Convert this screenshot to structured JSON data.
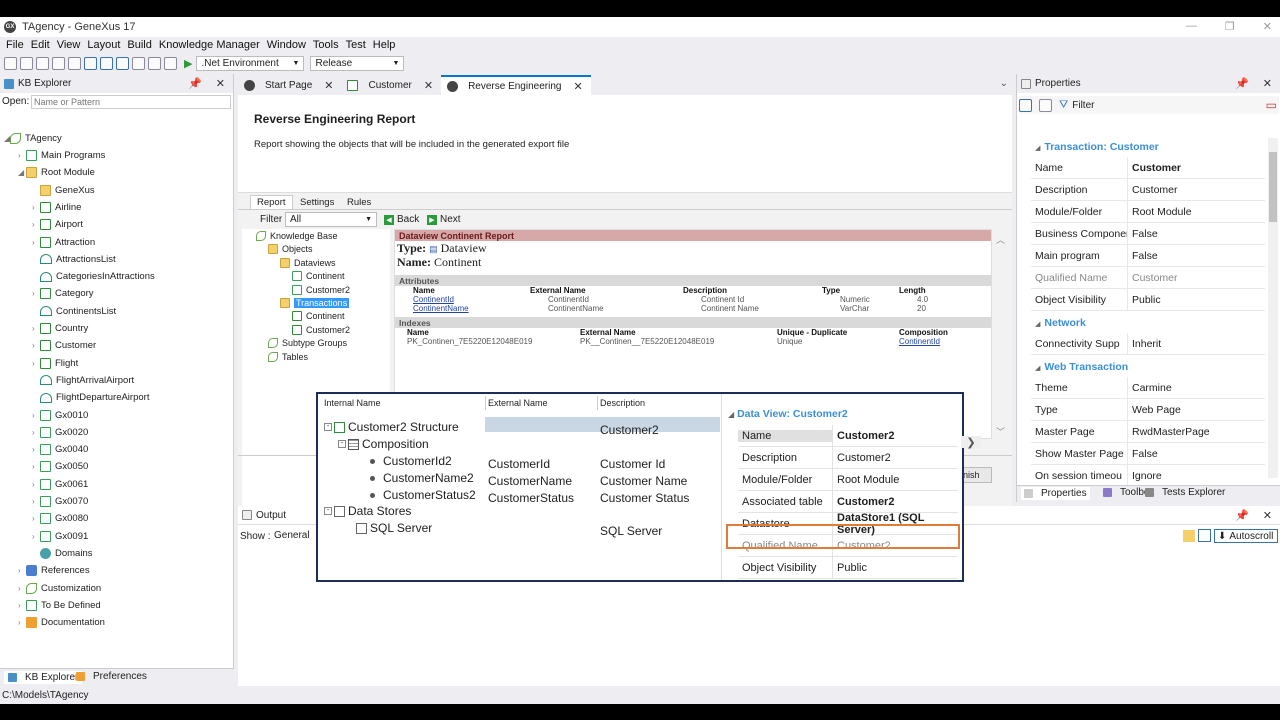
{
  "app": {
    "title": "TAgency - GeneXus 17"
  },
  "menu": [
    "File",
    "Edit",
    "View",
    "Layout",
    "Build",
    "Knowledge Manager",
    "Window",
    "Tools",
    "Test",
    "Help"
  ],
  "toolbar": {
    "environment": ".Net Environment",
    "config": "Release"
  },
  "kb_explorer": {
    "title": "KB Explorer",
    "open_label": "Open:",
    "open_placeholder": "Name or Pattern",
    "root": "TAgency",
    "items": [
      {
        "label": "Main Programs"
      },
      {
        "label": "Root Module"
      },
      {
        "label": "GeneXus"
      },
      {
        "label": "Airline"
      },
      {
        "label": "Airport"
      },
      {
        "label": "Attraction"
      },
      {
        "label": "AttractionsList"
      },
      {
        "label": "CategoriesInAttractions"
      },
      {
        "label": "Category"
      },
      {
        "label": "ContinentsList"
      },
      {
        "label": "Country"
      },
      {
        "label": "Customer"
      },
      {
        "label": "Flight"
      },
      {
        "label": "FlightArrivalAirport"
      },
      {
        "label": "FlightDepartureAirport"
      },
      {
        "label": "Gx0010"
      },
      {
        "label": "Gx0020"
      },
      {
        "label": "Gx0040"
      },
      {
        "label": "Gx0050"
      },
      {
        "label": "Gx0061"
      },
      {
        "label": "Gx0070"
      },
      {
        "label": "Gx0080"
      },
      {
        "label": "Gx0091"
      },
      {
        "label": "Domains"
      },
      {
        "label": "References"
      },
      {
        "label": "Customization"
      },
      {
        "label": "To Be Defined"
      },
      {
        "label": "Documentation"
      }
    ],
    "bottom_tabs": [
      "KB Explorer",
      "Preferences"
    ]
  },
  "tabs": [
    "Start Page",
    "Customer",
    "Reverse Engineering"
  ],
  "report": {
    "title": "Reverse Engineering Report",
    "subtitle": "Report showing the objects that will be included in the generated export file",
    "inner_tabs": [
      "Report",
      "Settings",
      "Rules"
    ],
    "filter_label": "Filter",
    "filter_value": "All",
    "back": "Back",
    "next": "Next",
    "tree": [
      "Knowledge Base",
      "Objects",
      "Dataviews",
      "Continent",
      "Customer2",
      "Transactions",
      "Continent",
      "Customer2",
      "Subtype Groups",
      "Tables"
    ],
    "view": {
      "header": "Dataview Continent Report",
      "type_label": "Type:",
      "type_value": "Dataview",
      "name_label": "Name:",
      "name_value": "Continent",
      "attributes_label": "Attributes",
      "attr_cols": [
        "Name",
        "External Name",
        "Description",
        "Type",
        "Length"
      ],
      "attr_rows": [
        [
          "ContinentId",
          "ContinentId",
          "Continent Id",
          "Numeric",
          "4.0"
        ],
        [
          "ContinentName",
          "ContinentName",
          "Continent Name",
          "VarChar",
          "20"
        ]
      ],
      "indexes_label": "Indexes",
      "idx_cols": [
        "Name",
        "External Name",
        "Unique - Duplicate",
        "Composition"
      ],
      "idx_row": [
        "PK_Continen_7E5220E12048E019",
        "PK__Continen__7E5220E12048E019",
        "Unique",
        "ContinentId"
      ]
    },
    "finish_fragment": "nish"
  },
  "overlay": {
    "cols": [
      "Internal Name",
      "External Name",
      "Description"
    ],
    "rows": [
      {
        "name": "Customer2 Structure",
        "ext": "",
        "desc": "Customer2"
      },
      {
        "name": "Composition",
        "ext": "",
        "desc": ""
      },
      {
        "name": "CustomerId2",
        "ext": "CustomerId",
        "desc": "Customer Id"
      },
      {
        "name": "CustomerName2",
        "ext": "CustomerName",
        "desc": "Customer Name"
      },
      {
        "name": "CustomerStatus2",
        "ext": "CustomerStatus",
        "desc": "Customer Status"
      },
      {
        "name": "Data Stores",
        "ext": "",
        "desc": ""
      },
      {
        "name": "SQL Server",
        "ext": "",
        "desc": "SQL Server"
      }
    ],
    "props_title": "Data View: Customer2",
    "props": [
      [
        "Name",
        "Customer2"
      ],
      [
        "Description",
        "Customer2"
      ],
      [
        "Module/Folder",
        "Root Module"
      ],
      [
        "Associated table",
        "Customer2"
      ],
      [
        "Datastore",
        "DataStore1 (SQL Server)"
      ],
      [
        "Qualified Name",
        "Customer2"
      ],
      [
        "Object Visibility",
        "Public"
      ]
    ]
  },
  "properties": {
    "title": "Properties",
    "filter": "Filter",
    "section1": "Transaction: Customer",
    "rows1": [
      [
        "Name",
        "Customer"
      ],
      [
        "Description",
        "Customer"
      ],
      [
        "Module/Folder",
        "Root Module"
      ],
      [
        "Business Componen",
        "False"
      ],
      [
        "Main program",
        "False"
      ],
      [
        "Qualified Name",
        "Customer"
      ],
      [
        "Object Visibility",
        "Public"
      ]
    ],
    "section2": "Network",
    "rows2": [
      [
        "Connectivity Supp",
        "Inherit"
      ]
    ],
    "section3": "Web Transaction",
    "rows3": [
      [
        "Theme",
        "Carmine"
      ],
      [
        "Type",
        "Web Page"
      ],
      [
        "Master Page",
        "RwdMasterPage"
      ],
      [
        "Show Master Page",
        "False"
      ],
      [
        "On session timeou",
        "Ignore"
      ]
    ],
    "bottom_tabs": [
      "Properties",
      "Toolbox",
      "Tests Explorer"
    ]
  },
  "output": {
    "title": "Output",
    "show_label": "Show :",
    "show_value": "General",
    "autoscroll": "Autoscroll"
  },
  "status": {
    "path": "C:\\Models\\TAgency"
  }
}
